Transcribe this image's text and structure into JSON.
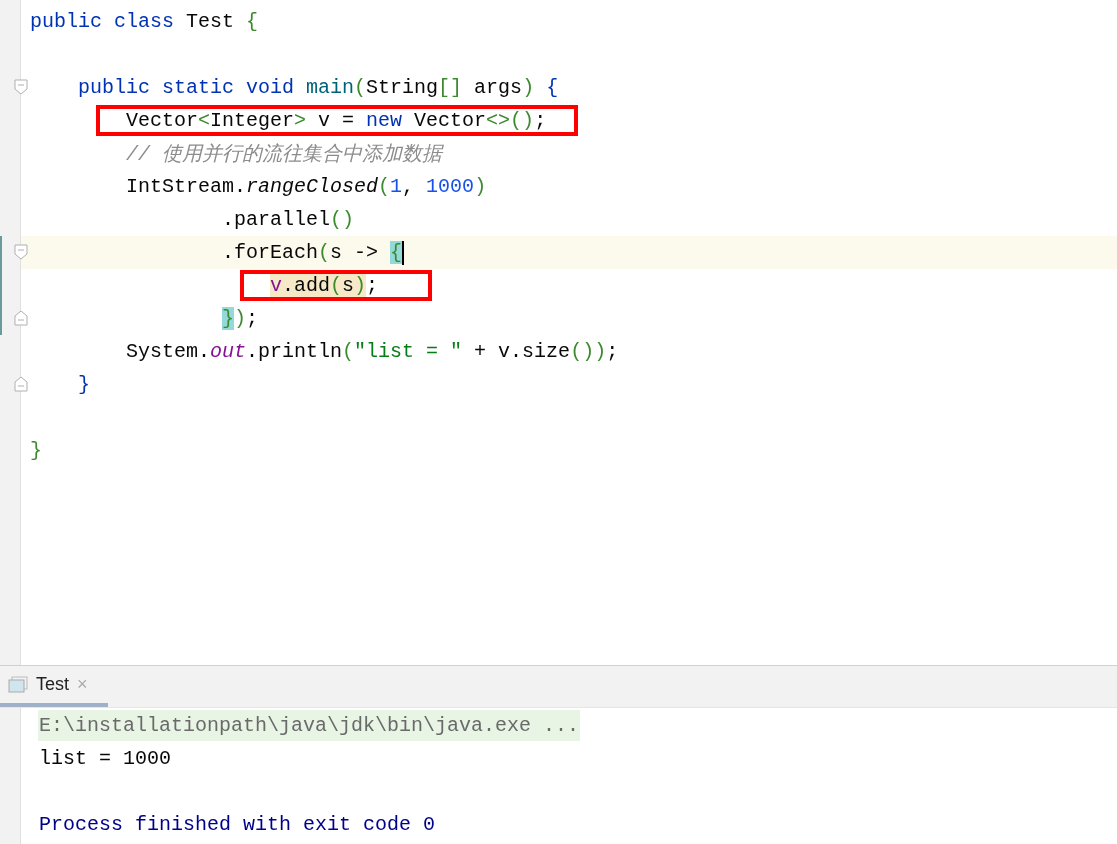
{
  "editor": {
    "lines": [
      {
        "kind": "code",
        "tokens": [
          {
            "t": "public class ",
            "kind": "kw"
          },
          {
            "t": "Test ",
            "kind": "plain"
          },
          {
            "t": "{",
            "kind": "punct"
          }
        ],
        "children": [
          {
            "kind": "blank"
          },
          {
            "kind": "code",
            "fold_start": true,
            "tokens": [
              {
                "t": "public static void ",
                "kind": "kw"
              },
              {
                "t": "main",
                "kind": "decl"
              },
              {
                "t": "(",
                "kind": "punct"
              },
              {
                "t": "String",
                "kind": "plain"
              },
              {
                "t": "[]",
                "kind": "punct"
              },
              {
                "t": " args",
                "kind": "plain"
              },
              {
                "t": ")",
                "kind": "punct"
              },
              {
                "t": " {",
                "kind": "kw"
              }
            ],
            "children": [
              {
                "kind": "code",
                "boxed": true,
                "tokens": [
                  {
                    "t": "Vector",
                    "kind": "plain"
                  },
                  {
                    "t": "<",
                    "kind": "punct"
                  },
                  {
                    "t": "Integer",
                    "kind": "plain"
                  },
                  {
                    "t": ">",
                    "kind": "punct"
                  },
                  {
                    "t": " v = ",
                    "kind": "plain"
                  },
                  {
                    "t": "new ",
                    "kind": "kw"
                  },
                  {
                    "t": "Vector",
                    "kind": "plain"
                  },
                  {
                    "t": "<>()",
                    "kind": "punct"
                  },
                  {
                    "t": ";",
                    "kind": "plain"
                  }
                ]
              },
              {
                "kind": "code",
                "tokens": [
                  {
                    "t": "// 使用并行的流往集合中添加数据",
                    "kind": "comment"
                  }
                ]
              },
              {
                "kind": "code",
                "continuation": true,
                "tokens": [
                  {
                    "t": "IntStream.",
                    "kind": "plain"
                  },
                  {
                    "t": "rangeClosed",
                    "kind": "static"
                  },
                  {
                    "t": "(",
                    "kind": "punct"
                  },
                  {
                    "t": "1",
                    "kind": "num"
                  },
                  {
                    "t": ", ",
                    "kind": "plain"
                  },
                  {
                    "t": "1000",
                    "kind": "num"
                  },
                  {
                    "t": ")",
                    "kind": "punct"
                  }
                ],
                "children": [
                  {
                    "kind": "code",
                    "tokens": [
                      {
                        "t": ".parallel",
                        "kind": "plain"
                      },
                      {
                        "t": "()",
                        "kind": "punct"
                      }
                    ]
                  },
                  {
                    "kind": "code",
                    "current": true,
                    "changed": true,
                    "fold_start": true,
                    "caret": true,
                    "tokens": [
                      {
                        "t": ".forEach",
                        "kind": "plain"
                      },
                      {
                        "t": "(",
                        "kind": "punct"
                      },
                      {
                        "t": "s -> ",
                        "kind": "plain"
                      },
                      {
                        "t": "{",
                        "kind": "punct",
                        "brace_match": true
                      }
                    ],
                    "children": [
                      {
                        "kind": "code",
                        "boxed": true,
                        "changed": true,
                        "tokens": [
                          {
                            "t": "v",
                            "kind": "captured",
                            "usage": true
                          },
                          {
                            "t": ".add",
                            "kind": "plain",
                            "usage": true
                          },
                          {
                            "t": "(",
                            "kind": "punct",
                            "usage": true
                          },
                          {
                            "t": "s",
                            "kind": "plain",
                            "usage": true
                          },
                          {
                            "t": ")",
                            "kind": "punct",
                            "usage": true
                          },
                          {
                            "t": ";",
                            "kind": "plain"
                          }
                        ]
                      }
                    ]
                  },
                  {
                    "kind": "code",
                    "changed": true,
                    "fold_end": true,
                    "tokens": [
                      {
                        "t": "}",
                        "kind": "punct",
                        "brace_match": true
                      },
                      {
                        "t": ")",
                        "kind": "punct"
                      },
                      {
                        "t": ";",
                        "kind": "plain"
                      }
                    ]
                  }
                ]
              },
              {
                "kind": "code",
                "tokens": [
                  {
                    "t": "System.",
                    "kind": "plain"
                  },
                  {
                    "t": "out",
                    "kind": "field"
                  },
                  {
                    "t": ".println",
                    "kind": "plain"
                  },
                  {
                    "t": "(",
                    "kind": "punct"
                  },
                  {
                    "t": "\"list = \"",
                    "kind": "str"
                  },
                  {
                    "t": " + v.size",
                    "kind": "plain"
                  },
                  {
                    "t": "()",
                    "kind": "punct"
                  },
                  {
                    "t": ")",
                    "kind": "punct"
                  },
                  {
                    "t": ";",
                    "kind": "plain"
                  }
                ]
              }
            ]
          },
          {
            "kind": "code",
            "fold_end": true,
            "tokens": [
              {
                "t": "}",
                "kind": "kw"
              }
            ]
          },
          {
            "kind": "blank"
          }
        ]
      },
      {
        "kind": "code",
        "tokens": [
          {
            "t": "}",
            "kind": "punct"
          }
        ]
      }
    ]
  },
  "run_panel": {
    "tabs": [
      {
        "label": "Test",
        "close": "×",
        "selected": true
      }
    ],
    "console": [
      {
        "kind": "command",
        "text": "E:\\installationpath\\java\\jdk\\bin\\java.exe ..."
      },
      {
        "kind": "output",
        "text": "list = 1000"
      },
      {
        "kind": "blank"
      },
      {
        "kind": "system",
        "text": "Process finished with exit code 0"
      }
    ]
  }
}
